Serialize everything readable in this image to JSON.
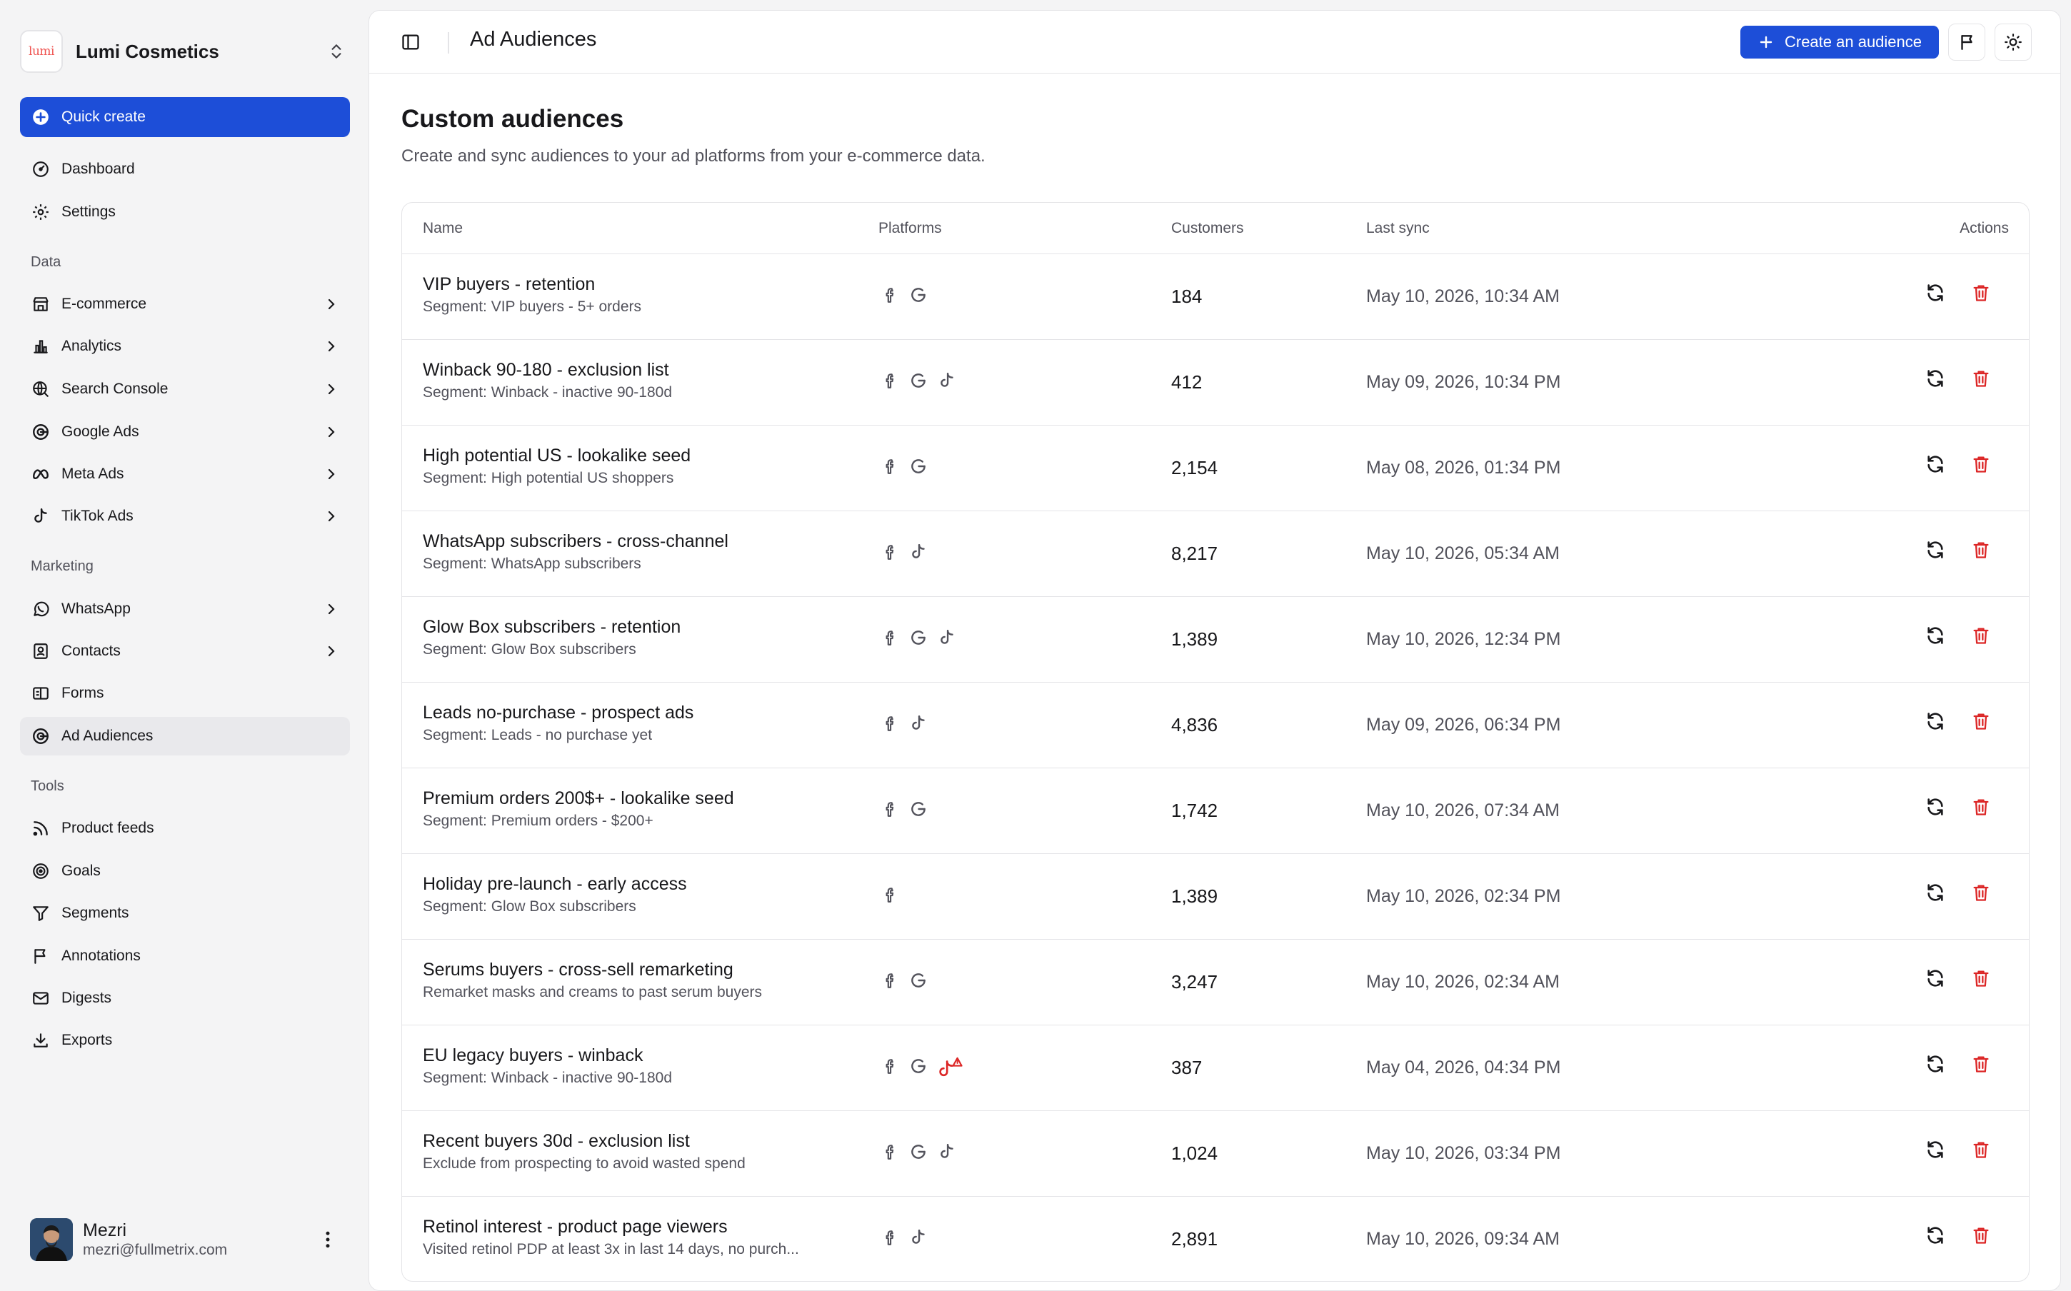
{
  "brand": {
    "name": "Lumi Cosmetics",
    "logo_text": "lumi"
  },
  "sidebar": {
    "quick_create": "Quick create",
    "top_items": [
      {
        "label": "Dashboard",
        "icon": "dashboard-icon"
      },
      {
        "label": "Settings",
        "icon": "gear-icon"
      }
    ],
    "data_label": "Data",
    "data_items": [
      {
        "label": "E-commerce",
        "icon": "store-icon"
      },
      {
        "label": "Analytics",
        "icon": "bar-chart-icon"
      },
      {
        "label": "Search Console",
        "icon": "search-globe-icon"
      },
      {
        "label": "Google Ads",
        "icon": "google-icon"
      },
      {
        "label": "Meta Ads",
        "icon": "meta-icon"
      },
      {
        "label": "TikTok Ads",
        "icon": "tiktok-icon"
      }
    ],
    "marketing_label": "Marketing",
    "marketing_items": [
      {
        "label": "WhatsApp",
        "icon": "whatsapp-icon"
      },
      {
        "label": "Contacts",
        "icon": "contacts-icon"
      },
      {
        "label": "Forms",
        "icon": "forms-icon"
      },
      {
        "label": "Ad Audiences",
        "icon": "target-icon"
      }
    ],
    "tools_label": "Tools",
    "tools_items": [
      {
        "label": "Product feeds",
        "icon": "rss-icon"
      },
      {
        "label": "Goals",
        "icon": "goal-icon"
      },
      {
        "label": "Segments",
        "icon": "filter-icon"
      },
      {
        "label": "Annotations",
        "icon": "flag-icon"
      },
      {
        "label": "Digests",
        "icon": "mail-icon"
      },
      {
        "label": "Exports",
        "icon": "download-icon"
      }
    ]
  },
  "user": {
    "name": "Mezri",
    "email": "mezri@fullmetrix.com"
  },
  "topbar": {
    "title": "Ad Audiences",
    "create_label": "Create an audience"
  },
  "page": {
    "title": "Custom audiences",
    "subtitle": "Create and sync audiences to your ad platforms from your e-commerce data."
  },
  "table": {
    "columns": {
      "name": "Name",
      "platforms": "Platforms",
      "customers": "Customers",
      "last_sync": "Last sync",
      "actions": "Actions"
    },
    "rows": [
      {
        "name": "VIP buyers - retention",
        "sub": "Segment: VIP buyers - 5+ orders",
        "platforms": [
          "meta",
          "google"
        ],
        "customers": "184",
        "last_sync": "May 10, 2026, 10:34 AM"
      },
      {
        "name": "Winback 90-180 - exclusion list",
        "sub": "Segment: Winback - inactive 90-180d",
        "platforms": [
          "meta",
          "google",
          "tiktok"
        ],
        "customers": "412",
        "last_sync": "May 09, 2026, 10:34 PM"
      },
      {
        "name": "High potential US - lookalike seed",
        "sub": "Segment: High potential US shoppers",
        "platforms": [
          "meta",
          "google"
        ],
        "customers": "2,154",
        "last_sync": "May 08, 2026, 01:34 PM"
      },
      {
        "name": "WhatsApp subscribers - cross-channel",
        "sub": "Segment: WhatsApp subscribers",
        "platforms": [
          "meta",
          "tiktok"
        ],
        "customers": "8,217",
        "last_sync": "May 10, 2026, 05:34 AM"
      },
      {
        "name": "Glow Box subscribers - retention",
        "sub": "Segment: Glow Box subscribers",
        "platforms": [
          "meta",
          "google",
          "tiktok"
        ],
        "customers": "1,389",
        "last_sync": "May 10, 2026, 12:34 PM"
      },
      {
        "name": "Leads no-purchase - prospect ads",
        "sub": "Segment: Leads - no purchase yet",
        "platforms": [
          "meta",
          "tiktok"
        ],
        "customers": "4,836",
        "last_sync": "May 09, 2026, 06:34 PM"
      },
      {
        "name": "Premium orders 200$+ - lookalike seed",
        "sub": "Segment: Premium orders - $200+",
        "platforms": [
          "meta",
          "google"
        ],
        "customers": "1,742",
        "last_sync": "May 10, 2026, 07:34 AM"
      },
      {
        "name": "Holiday pre-launch - early access",
        "sub": "Segment: Glow Box subscribers",
        "platforms": [
          "meta"
        ],
        "customers": "1,389",
        "last_sync": "May 10, 2026, 02:34 PM"
      },
      {
        "name": "Serums buyers - cross-sell remarketing",
        "sub": "Remarket masks and creams to past serum buyers",
        "platforms": [
          "meta",
          "google"
        ],
        "customers": "3,247",
        "last_sync": "May 10, 2026, 02:34 AM"
      },
      {
        "name": "EU legacy buyers - winback",
        "sub": "Segment: Winback - inactive 90-180d",
        "platforms": [
          "meta",
          "google",
          "tiktok-error"
        ],
        "customers": "387",
        "last_sync": "May 04, 2026, 04:34 PM"
      },
      {
        "name": "Recent buyers 30d - exclusion list",
        "sub": "Exclude from prospecting to avoid wasted spend",
        "platforms": [
          "meta",
          "google",
          "tiktok"
        ],
        "customers": "1,024",
        "last_sync": "May 10, 2026, 03:34 PM"
      },
      {
        "name": "Retinol interest - product page viewers",
        "sub": "Visited retinol PDP at least 3x in last 14 days, no purch...",
        "platforms": [
          "meta",
          "tiktok"
        ],
        "customers": "2,891",
        "last_sync": "May 10, 2026, 09:34 AM"
      }
    ]
  },
  "colors": {
    "accent": "#1d4ed8",
    "danger": "#dc2626",
    "muted": "#52525b"
  }
}
